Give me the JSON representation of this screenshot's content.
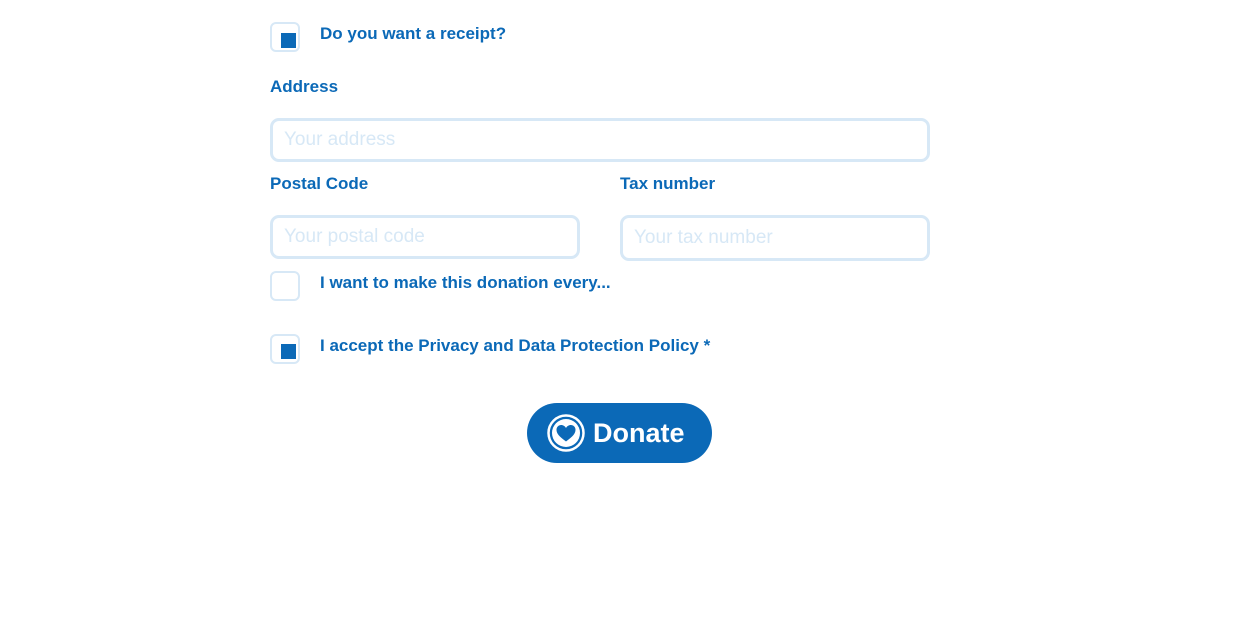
{
  "form": {
    "receipt": {
      "label": "Do you want a receipt?",
      "checked": true
    },
    "address": {
      "label": "Address",
      "placeholder": "Your address",
      "value": ""
    },
    "postal_code": {
      "label": "Postal Code",
      "placeholder": "Your postal code",
      "value": ""
    },
    "tax_number": {
      "label": "Tax number",
      "placeholder": "Your tax number",
      "value": ""
    },
    "recurring": {
      "label": "I want to make this donation every...",
      "checked": false
    },
    "privacy": {
      "label": "I accept the Privacy and Data Protection Policy *",
      "checked": true
    },
    "donate_button": {
      "label": "Donate",
      "icon": "heart-icon"
    }
  },
  "colors": {
    "accent": "#0b69b7",
    "input_border": "#d7e8f6",
    "placeholder": "#d7e8f6",
    "background": "#ffffff"
  }
}
